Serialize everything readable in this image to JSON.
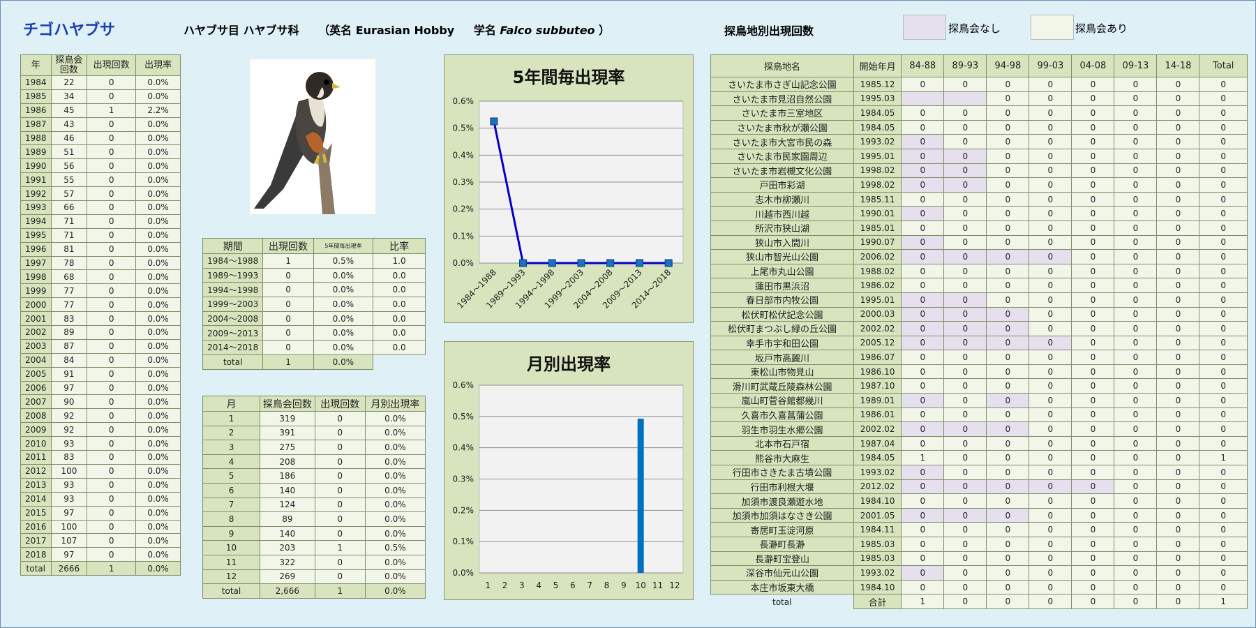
{
  "header": {
    "species": "チゴハヤブサ",
    "order_family": "ハヤブサ目 ハヤブサ科",
    "english_prefix": "（英名 Eurasian Hobby",
    "sci_prefix": "学名",
    "sci_name": "Falco subbuteo",
    "sci_suffix": "）",
    "site_title": "探鳥地別出現回数",
    "legend": [
      {
        "label": "探鳥会なし",
        "color": "#e6e0ee"
      },
      {
        "label": "探鳥会あり",
        "color": "#f2f6e8"
      }
    ]
  },
  "colors": {
    "header_green": "#d7e4bd",
    "cell_light": "#f2f6e8",
    "cell_purple": "#e6e0ee",
    "line": "#0000c8",
    "marker": "#1f6fbf",
    "bar": "#0070c0"
  },
  "year_table": {
    "headers": [
      "年",
      "探鳥会回数",
      "出現回数",
      "出現率"
    ],
    "rows": [
      [
        "1984",
        "22",
        "0",
        "0.0%"
      ],
      [
        "1985",
        "34",
        "0",
        "0.0%"
      ],
      [
        "1986",
        "45",
        "1",
        "2.2%"
      ],
      [
        "1987",
        "43",
        "0",
        "0.0%"
      ],
      [
        "1988",
        "46",
        "0",
        "0.0%"
      ],
      [
        "1989",
        "51",
        "0",
        "0.0%"
      ],
      [
        "1990",
        "56",
        "0",
        "0.0%"
      ],
      [
        "1991",
        "55",
        "0",
        "0.0%"
      ],
      [
        "1992",
        "57",
        "0",
        "0.0%"
      ],
      [
        "1993",
        "66",
        "0",
        "0.0%"
      ],
      [
        "1994",
        "71",
        "0",
        "0.0%"
      ],
      [
        "1995",
        "71",
        "0",
        "0.0%"
      ],
      [
        "1996",
        "81",
        "0",
        "0.0%"
      ],
      [
        "1997",
        "78",
        "0",
        "0.0%"
      ],
      [
        "1998",
        "68",
        "0",
        "0.0%"
      ],
      [
        "1999",
        "77",
        "0",
        "0.0%"
      ],
      [
        "2000",
        "77",
        "0",
        "0.0%"
      ],
      [
        "2001",
        "83",
        "0",
        "0.0%"
      ],
      [
        "2002",
        "89",
        "0",
        "0.0%"
      ],
      [
        "2003",
        "87",
        "0",
        "0.0%"
      ],
      [
        "2004",
        "84",
        "0",
        "0.0%"
      ],
      [
        "2005",
        "91",
        "0",
        "0.0%"
      ],
      [
        "2006",
        "97",
        "0",
        "0.0%"
      ],
      [
        "2007",
        "90",
        "0",
        "0.0%"
      ],
      [
        "2008",
        "92",
        "0",
        "0.0%"
      ],
      [
        "2009",
        "92",
        "0",
        "0.0%"
      ],
      [
        "2010",
        "93",
        "0",
        "0.0%"
      ],
      [
        "2011",
        "83",
        "0",
        "0.0%"
      ],
      [
        "2012",
        "100",
        "0",
        "0.0%"
      ],
      [
        "2013",
        "93",
        "0",
        "0.0%"
      ],
      [
        "2014",
        "93",
        "0",
        "0.0%"
      ],
      [
        "2015",
        "97",
        "0",
        "0.0%"
      ],
      [
        "2016",
        "100",
        "0",
        "0.0%"
      ],
      [
        "2017",
        "107",
        "0",
        "0.0%"
      ],
      [
        "2018",
        "97",
        "0",
        "0.0%"
      ]
    ],
    "total": [
      "total",
      "2666",
      "1",
      "0.0%"
    ]
  },
  "period_table": {
    "headers": [
      "期間",
      "出現回数",
      "5年間毎出現率",
      "比率"
    ],
    "rows": [
      [
        "1984～1988",
        "1",
        "0.5%",
        "1.0"
      ],
      [
        "1989～1993",
        "0",
        "0.0%",
        "0.0"
      ],
      [
        "1994～1998",
        "0",
        "0.0%",
        "0.0"
      ],
      [
        "1999～2003",
        "0",
        "0.0%",
        "0.0"
      ],
      [
        "2004～2008",
        "0",
        "0.0%",
        "0.0"
      ],
      [
        "2009～2013",
        "0",
        "0.0%",
        "0.0"
      ],
      [
        "2014～2018",
        "0",
        "0.0%",
        "0.0"
      ]
    ],
    "total": [
      "total",
      "1",
      "0.0%"
    ]
  },
  "month_table": {
    "headers": [
      "月",
      "探鳥会回数",
      "出現回数",
      "月別出現率"
    ],
    "rows": [
      [
        "1",
        "319",
        "0",
        "0.0%"
      ],
      [
        "2",
        "391",
        "0",
        "0.0%"
      ],
      [
        "3",
        "275",
        "0",
        "0.0%"
      ],
      [
        "4",
        "208",
        "0",
        "0.0%"
      ],
      [
        "5",
        "186",
        "0",
        "0.0%"
      ],
      [
        "6",
        "140",
        "0",
        "0.0%"
      ],
      [
        "7",
        "124",
        "0",
        "0.0%"
      ],
      [
        "8",
        "89",
        "0",
        "0.0%"
      ],
      [
        "9",
        "140",
        "0",
        "0.0%"
      ],
      [
        "10",
        "203",
        "1",
        "0.5%"
      ],
      [
        "11",
        "322",
        "0",
        "0.0%"
      ],
      [
        "12",
        "269",
        "0",
        "0.0%"
      ]
    ],
    "total": [
      "total",
      "2,666",
      "1",
      "0.0%"
    ]
  },
  "site_table": {
    "headers": [
      "探鳥地名",
      "開始年月",
      "84-88",
      "89-93",
      "94-98",
      "99-03",
      "04-08",
      "09-13",
      "14-18",
      "Total"
    ],
    "rows": [
      {
        "name": "さいたま市さぎ山記念公園",
        "start": "1985.12",
        "v": [
          "0",
          "0",
          "0",
          "0",
          "0",
          "0",
          "0",
          "0"
        ],
        "p": []
      },
      {
        "name": "さいたま市見沼自然公園",
        "start": "1995.03",
        "v": [
          "",
          "",
          "0",
          "0",
          "0",
          "0",
          "0",
          "0"
        ],
        "p": [
          0,
          1
        ]
      },
      {
        "name": "さいたま市三室地区",
        "start": "1984.05",
        "v": [
          "0",
          "0",
          "0",
          "0",
          "0",
          "0",
          "0",
          "0"
        ],
        "p": []
      },
      {
        "name": "さいたま市秋が瀬公園",
        "start": "1984.05",
        "v": [
          "0",
          "0",
          "0",
          "0",
          "0",
          "0",
          "0",
          "0"
        ],
        "p": []
      },
      {
        "name": "さいたま市大宮市民の森",
        "start": "1993.02",
        "v": [
          "0",
          "0",
          "0",
          "0",
          "0",
          "0",
          "0",
          "0"
        ],
        "p": [
          0
        ]
      },
      {
        "name": "さいたま市民家園周辺",
        "start": "1995.01",
        "v": [
          "0",
          "0",
          "0",
          "0",
          "0",
          "0",
          "0",
          "0"
        ],
        "p": [
          0,
          1
        ]
      },
      {
        "name": "さいたま市岩槻文化公園",
        "start": "1998.02",
        "v": [
          "0",
          "0",
          "0",
          "0",
          "0",
          "0",
          "0",
          "0"
        ],
        "p": [
          0,
          1
        ]
      },
      {
        "name": "戸田市彩湖",
        "start": "1998.02",
        "v": [
          "0",
          "0",
          "0",
          "0",
          "0",
          "0",
          "0",
          "0"
        ],
        "p": [
          0,
          1
        ]
      },
      {
        "name": "志木市柳瀬川",
        "start": "1985.11",
        "v": [
          "0",
          "0",
          "0",
          "0",
          "0",
          "0",
          "0",
          "0"
        ],
        "p": []
      },
      {
        "name": "川越市西川越",
        "start": "1990.01",
        "v": [
          "0",
          "0",
          "0",
          "0",
          "0",
          "0",
          "0",
          "0"
        ],
        "p": [
          0
        ]
      },
      {
        "name": "所沢市狭山湖",
        "start": "1985.01",
        "v": [
          "0",
          "0",
          "0",
          "0",
          "0",
          "0",
          "0",
          "0"
        ],
        "p": []
      },
      {
        "name": "狭山市入間川",
        "start": "1990.07",
        "v": [
          "0",
          "0",
          "0",
          "0",
          "0",
          "0",
          "0",
          "0"
        ],
        "p": [
          0
        ]
      },
      {
        "name": "狭山市智光山公園",
        "start": "2006.02",
        "v": [
          "0",
          "0",
          "0",
          "0",
          "0",
          "0",
          "0",
          "0"
        ],
        "p": [
          0,
          1,
          2,
          3
        ]
      },
      {
        "name": "上尾市丸山公園",
        "start": "1988.02",
        "v": [
          "0",
          "0",
          "0",
          "0",
          "0",
          "0",
          "0",
          "0"
        ],
        "p": []
      },
      {
        "name": "蓮田市黒浜沼",
        "start": "1986.02",
        "v": [
          "0",
          "0",
          "0",
          "0",
          "0",
          "0",
          "0",
          "0"
        ],
        "p": []
      },
      {
        "name": "春日部市内牧公園",
        "start": "1995.01",
        "v": [
          "0",
          "0",
          "0",
          "0",
          "0",
          "0",
          "0",
          "0"
        ],
        "p": [
          0,
          1
        ]
      },
      {
        "name": "松伏町松伏記念公園",
        "start": "2000.03",
        "v": [
          "0",
          "0",
          "0",
          "0",
          "0",
          "0",
          "0",
          "0"
        ],
        "p": [
          0,
          1,
          2
        ]
      },
      {
        "name": "松伏町まつぶし緑の丘公園",
        "start": "2002.02",
        "v": [
          "0",
          "0",
          "0",
          "0",
          "0",
          "0",
          "0",
          "0"
        ],
        "p": [
          0,
          1,
          2
        ]
      },
      {
        "name": "幸手市宇和田公園",
        "start": "2005.12",
        "v": [
          "0",
          "0",
          "0",
          "0",
          "0",
          "0",
          "0",
          "0"
        ],
        "p": [
          0,
          1,
          2,
          3
        ]
      },
      {
        "name": "坂戸市高麗川",
        "start": "1986.07",
        "v": [
          "0",
          "0",
          "0",
          "0",
          "0",
          "0",
          "0",
          "0"
        ],
        "p": []
      },
      {
        "name": "東松山市物見山",
        "start": "1986.10",
        "v": [
          "0",
          "0",
          "0",
          "0",
          "0",
          "0",
          "0",
          "0"
        ],
        "p": []
      },
      {
        "name": "滑川町武蔵丘陵森林公園",
        "start": "1987.10",
        "v": [
          "0",
          "0",
          "0",
          "0",
          "0",
          "0",
          "0",
          "0"
        ],
        "p": []
      },
      {
        "name": "嵐山町菅谷館都幾川",
        "start": "1989.01",
        "v": [
          "0",
          "0",
          "0",
          "0",
          "0",
          "0",
          "0",
          "0"
        ],
        "p": [
          0,
          2
        ]
      },
      {
        "name": "久喜市久喜菖蒲公園",
        "start": "1986.01",
        "v": [
          "0",
          "0",
          "0",
          "0",
          "0",
          "0",
          "0",
          "0"
        ],
        "p": []
      },
      {
        "name": "羽生市羽生水郷公園",
        "start": "2002.02",
        "v": [
          "0",
          "0",
          "0",
          "0",
          "0",
          "0",
          "0",
          "0"
        ],
        "p": [
          0,
          1,
          2
        ]
      },
      {
        "name": "北本市石戸宿",
        "start": "1987.04",
        "v": [
          "0",
          "0",
          "0",
          "0",
          "0",
          "0",
          "0",
          "0"
        ],
        "p": []
      },
      {
        "name": "熊谷市大麻生",
        "start": "1984.05",
        "v": [
          "1",
          "0",
          "0",
          "0",
          "0",
          "0",
          "0",
          "1"
        ],
        "p": []
      },
      {
        "name": "行田市さきたま古墳公園",
        "start": "1993.02",
        "v": [
          "0",
          "0",
          "0",
          "0",
          "0",
          "0",
          "0",
          "0"
        ],
        "p": [
          0
        ]
      },
      {
        "name": "行田市利根大堰",
        "start": "2012.02",
        "v": [
          "0",
          "0",
          "0",
          "0",
          "0",
          "0",
          "0",
          "0"
        ],
        "p": [
          0,
          1,
          2,
          3,
          4
        ]
      },
      {
        "name": "加須市渡良瀬遊水地",
        "start": "1984.10",
        "v": [
          "0",
          "0",
          "0",
          "0",
          "0",
          "0",
          "0",
          "0"
        ],
        "p": []
      },
      {
        "name": "加須市加須はなさき公園",
        "start": "2001.05",
        "v": [
          "0",
          "0",
          "0",
          "0",
          "0",
          "0",
          "0",
          "0"
        ],
        "p": [
          0,
          1,
          2
        ]
      },
      {
        "name": "寄居町玉淀河原",
        "start": "1984.11",
        "v": [
          "0",
          "0",
          "0",
          "0",
          "0",
          "0",
          "0",
          "0"
        ],
        "p": []
      },
      {
        "name": "長瀞町長瀞",
        "start": "1985.03",
        "v": [
          "0",
          "0",
          "0",
          "0",
          "0",
          "0",
          "0",
          "0"
        ],
        "p": []
      },
      {
        "name": "長瀞町宝登山",
        "start": "1985.03",
        "v": [
          "0",
          "0",
          "0",
          "0",
          "0",
          "0",
          "0",
          "0"
        ],
        "p": []
      },
      {
        "name": "深谷市仙元山公園",
        "start": "1993.02",
        "v": [
          "0",
          "0",
          "0",
          "0",
          "0",
          "0",
          "0",
          "0"
        ],
        "p": [
          0
        ]
      },
      {
        "name": "本庄市坂東大橋",
        "start": "1984.10",
        "v": [
          "0",
          "0",
          "0",
          "0",
          "0",
          "0",
          "0",
          "0"
        ],
        "p": []
      }
    ],
    "footer": {
      "total_label": "total",
      "sum_label": "合計",
      "v": [
        "1",
        "0",
        "0",
        "0",
        "0",
        "0",
        "0",
        "1"
      ]
    }
  },
  "chart_data": [
    {
      "type": "line",
      "title": "5年間毎出現率",
      "categories": [
        "1984～1988",
        "1989～1993",
        "1994～1998",
        "1999～2003",
        "2004～2008",
        "2009～2013",
        "2014～2018"
      ],
      "values": [
        0.525,
        0,
        0,
        0,
        0,
        0,
        0
      ],
      "ylim": [
        0,
        0.6
      ],
      "yticks": [
        "0.0%",
        "0.1%",
        "0.2%",
        "0.3%",
        "0.4%",
        "0.5%",
        "0.6%"
      ],
      "grid": true
    },
    {
      "type": "bar",
      "title": "月別出現率",
      "categories": [
        "1",
        "2",
        "3",
        "4",
        "5",
        "6",
        "7",
        "8",
        "9",
        "10",
        "11",
        "12"
      ],
      "values": [
        0,
        0,
        0,
        0,
        0,
        0,
        0,
        0,
        0,
        0.493,
        0,
        0
      ],
      "ylim": [
        0,
        0.6
      ],
      "yticks": [
        "0.0%",
        "0.1%",
        "0.2%",
        "0.3%",
        "0.4%",
        "0.5%",
        "0.6%"
      ],
      "grid": true
    }
  ]
}
